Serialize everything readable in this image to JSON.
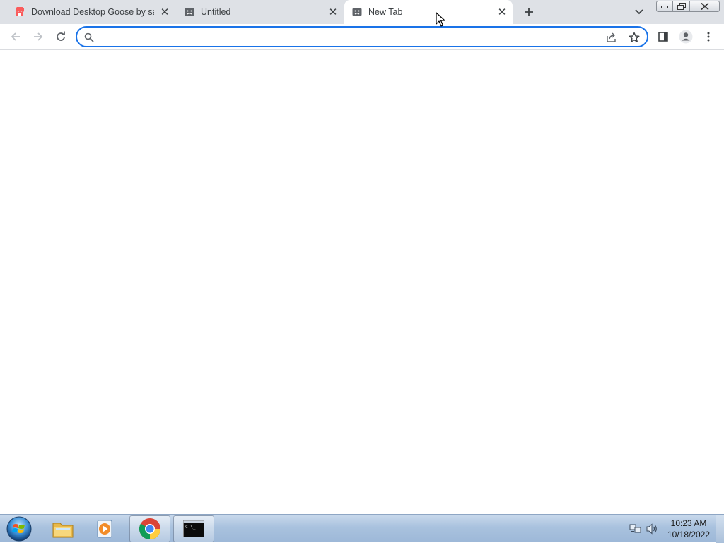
{
  "browser": {
    "tabs": [
      {
        "title": "Download Desktop Goose by sam",
        "favicon": "itch-io-icon",
        "active": false
      },
      {
        "title": "Untitled",
        "favicon": "sad-face-icon",
        "active": false
      },
      {
        "title": "New Tab",
        "favicon": "sad-face-icon",
        "active": true
      }
    ],
    "omnibox": {
      "value": "",
      "placeholder": ""
    },
    "accent_color": "#1a73e8"
  },
  "taskbar": {
    "apps": [
      "folder-icon",
      "media-player-icon",
      "chrome-icon",
      "terminal-icon"
    ],
    "clock": {
      "time": "10:23 AM",
      "date": "10/18/2022"
    }
  }
}
